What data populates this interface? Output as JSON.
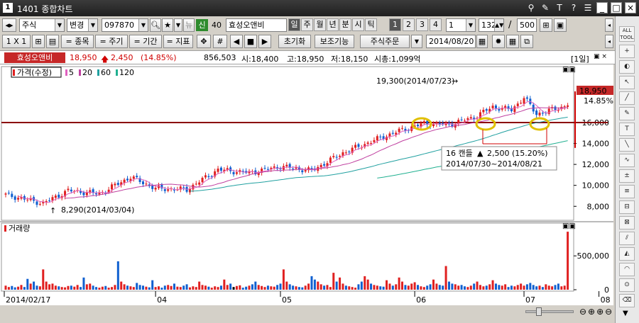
{
  "window": {
    "number": "1",
    "title": "1401 종합차트"
  },
  "toolbar1": {
    "market_type": "주식",
    "change_label": "변경",
    "stock_code": "097870",
    "new_label": "뉴",
    "badge": "신",
    "badge_num": "40",
    "stock_name": "효성오앤비",
    "periods": [
      "일",
      "주",
      "월",
      "년",
      "분",
      "시",
      "틱"
    ],
    "selected_period": "일",
    "nums": [
      "1",
      "2",
      "3",
      "4"
    ],
    "selected_num": "1",
    "interval_value": "1",
    "count_value": "132",
    "total_value": "500"
  },
  "toolbar2": {
    "scale_label": "1 X 1",
    "items": [
      "= 종목",
      "= 주기",
      "= 기간",
      "= 지표"
    ],
    "reset_label": "초기화",
    "aux_label": "보조기능",
    "order_label": "주식주문",
    "date_value": "2014/08/20"
  },
  "info": {
    "stock_name": "효성오앤비",
    "price": "18,950",
    "change": "2,450",
    "change_pct": "(14.85%)",
    "volume": "856,503",
    "open": "시:18,400",
    "high": "고:18,950",
    "low": "저:18,150",
    "market_cap": "시총:1,099억",
    "period_label": "[1일]"
  },
  "chart_data": [
    {
      "type": "candlestick",
      "legend": {
        "title": "가격(수정)",
        "ma": [
          "5",
          "20",
          "60",
          "120"
        ]
      },
      "x_ticks": [
        "2014/02/17",
        "04",
        "05",
        "06",
        "07",
        "08"
      ],
      "y_ticks": [
        8000,
        10000,
        12000,
        14000,
        16000
      ],
      "ylim": [
        6800,
        21000
      ],
      "last_price_label": "18,950",
      "last_pct_label": "14.85%",
      "horizontal_line": 16000,
      "annotations": {
        "high": "19,300(2014/07/23)",
        "low": "8,290(2014/03/04)",
        "box_line1_a": "16 캔들",
        "box_line1_b": "2,500 (15.20%)",
        "box_line2": "2014/07/30~2014/08/21"
      },
      "close_points": [
        {
          "i": 0,
          "close": 9100
        },
        {
          "i": 12,
          "close": 8290
        },
        {
          "i": 20,
          "close": 9500
        },
        {
          "i": 30,
          "close": 9200
        },
        {
          "i": 40,
          "close": 10800
        },
        {
          "i": 48,
          "close": 9700
        },
        {
          "i": 58,
          "close": 9600
        },
        {
          "i": 68,
          "close": 11500
        },
        {
          "i": 78,
          "close": 11200
        },
        {
          "i": 88,
          "close": 11800
        },
        {
          "i": 98,
          "close": 11400
        },
        {
          "i": 108,
          "close": 13100
        },
        {
          "i": 118,
          "close": 14300
        },
        {
          "i": 126,
          "close": 15200
        },
        {
          "i": 134,
          "close": 15900
        },
        {
          "i": 142,
          "close": 15800
        },
        {
          "i": 150,
          "close": 16500
        },
        {
          "i": 156,
          "close": 17500
        },
        {
          "i": 162,
          "close": 17200
        },
        {
          "i": 166,
          "close": 18400
        },
        {
          "i": 170,
          "close": 16800
        },
        {
          "i": 176,
          "close": 17300
        },
        {
          "i": 182,
          "close": 17800
        },
        {
          "i": 186,
          "close": 16600
        },
        {
          "i": 190,
          "close": 16500
        },
        {
          "i": 193,
          "close": 18950
        }
      ]
    },
    {
      "type": "bar",
      "legend": {
        "title": "거래량"
      },
      "y_ticks": [
        "0",
        "500,000"
      ],
      "ylim": [
        0,
        900000
      ],
      "volumes_k": [
        60,
        40,
        55,
        35,
        45,
        70,
        40,
        160,
        90,
        120,
        60,
        50,
        300,
        120,
        80,
        90,
        60,
        50,
        40,
        35,
        55,
        60,
        45,
        70,
        40,
        180,
        80,
        90,
        60,
        40,
        30,
        45,
        55,
        30,
        40,
        70,
        420,
        120,
        80,
        60,
        50,
        40,
        100,
        70,
        60,
        45,
        35,
        140,
        40,
        50,
        30,
        60,
        70,
        55,
        90,
        45,
        40,
        60,
        80,
        35,
        50,
        40,
        120,
        70,
        60,
        45,
        30,
        50,
        40,
        60,
        150,
        70,
        90,
        40,
        55,
        65,
        30,
        45,
        60,
        80,
        120,
        70,
        55,
        40,
        60,
        50,
        45,
        70,
        90,
        300,
        120,
        80,
        60,
        50,
        40,
        35,
        60,
        90,
        200,
        150,
        120,
        80,
        60,
        70,
        40,
        250,
        120,
        180,
        90,
        60,
        50,
        40,
        30,
        80,
        120,
        200,
        150,
        90,
        70,
        60,
        50,
        45,
        140,
        90,
        60,
        80,
        180,
        120,
        70,
        60,
        90,
        110,
        70,
        50,
        40,
        60,
        80,
        150,
        90,
        70,
        60,
        350,
        120,
        90,
        80,
        60,
        70,
        50,
        40,
        60,
        90,
        120,
        70,
        50,
        60,
        80,
        140,
        90,
        70,
        60,
        80,
        40,
        60,
        50,
        70,
        90,
        60,
        80,
        100,
        70,
        50,
        60,
        40,
        80,
        60,
        50,
        70,
        90,
        50,
        60,
        857
      ]
    }
  ]
}
